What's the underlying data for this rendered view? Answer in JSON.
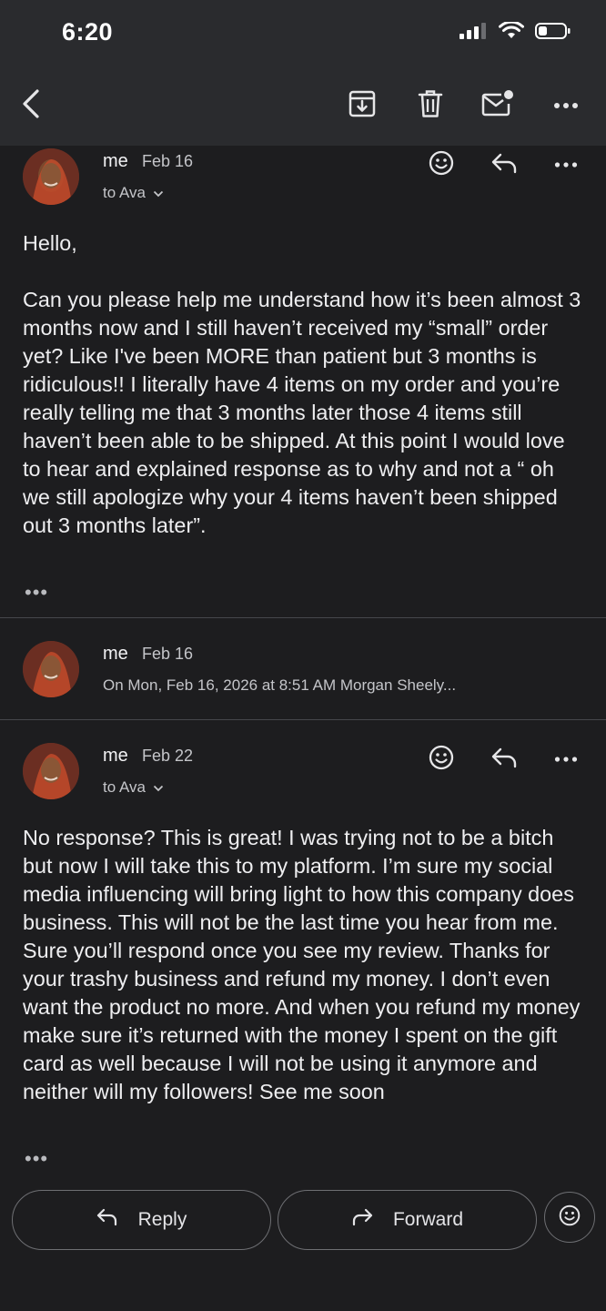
{
  "status": {
    "time": "6:20"
  },
  "messages": [
    {
      "sender": "me",
      "date": "Feb 16",
      "to": "to Ava",
      "greeting": "Hello,",
      "body": "Can you please help me understand how it’s been almost 3 months now and I still haven’t received my “small” order yet? Like I've been MORE than patient but 3 months is ridiculous!! I literally have 4 items on my order and you’re really telling me that 3 months later those 4 items still haven’t been able to be shipped. At this point I would love to hear and explained response as to why and not a “ oh we still apologize why your 4 items haven’t been shipped out 3 months later”.",
      "more": "•••"
    },
    {
      "sender": "me",
      "date": "Feb 16",
      "preview": "On Mon, Feb 16, 2026 at 8:51 AM Morgan Sheely..."
    },
    {
      "sender": "me",
      "date": "Feb 22",
      "to": "to Ava",
      "body": "No response? This is great! I was trying not to be a bitch but now I will take this to my platform. I’m sure my social media influencing will bring light to how this company does business. This will not be the last time you hear from me. Sure you’ll respond once you see my review. Thanks for your trashy business and refund my money. I don’t even want the product no more. And when you refund my money make sure it’s returned with the money I spent on the gift card as well because I will not be using it anymore and neither will my followers! See me soon",
      "more": "•••"
    }
  ],
  "actions": {
    "reply": "Reply",
    "forward": "Forward"
  },
  "icons": [
    "back-icon",
    "archive-icon",
    "delete-icon",
    "mark-unread-icon",
    "more-icon",
    "emoji-icon",
    "reply-icon",
    "forward-icon",
    "chevron-down-icon",
    "signal-icon",
    "wifi-icon",
    "battery-icon"
  ],
  "colors": {
    "background": "#1d1d1f",
    "toolbar": "#2a2b2e",
    "text": "#eeeef0",
    "secondary": "#c4c5c9",
    "border": "#6e6f73"
  }
}
